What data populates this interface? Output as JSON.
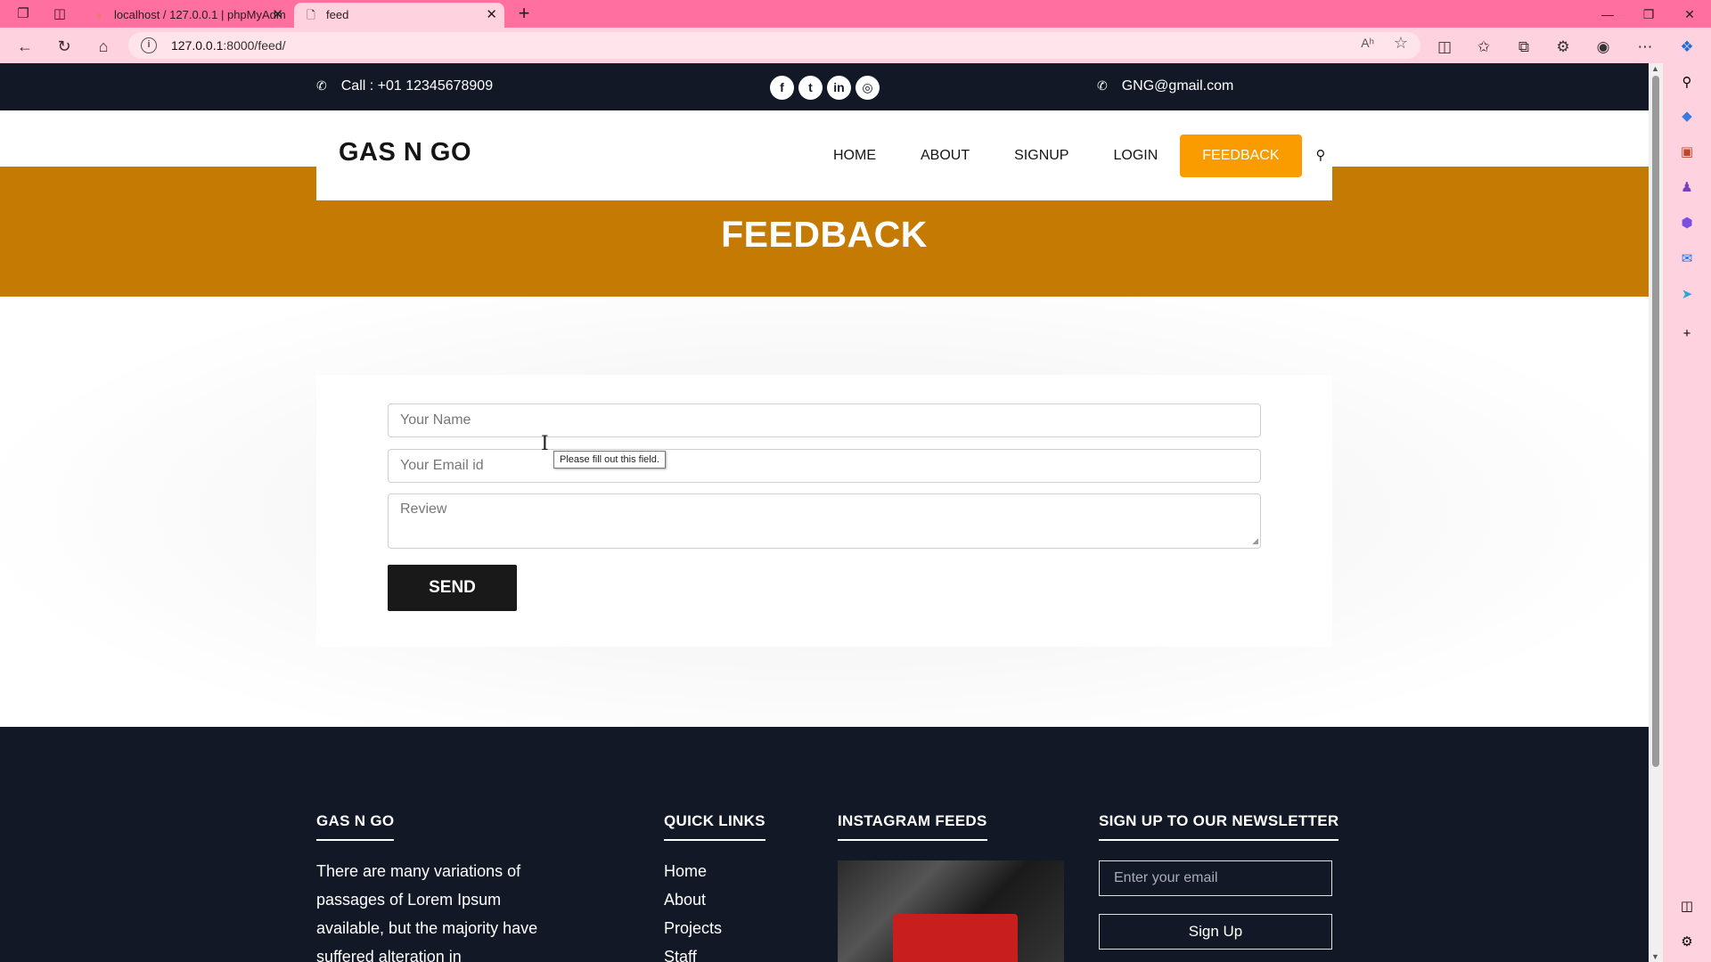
{
  "browser": {
    "tabs": [
      {
        "title": "localhost / 127.0.0.1 | phpMyAdm",
        "favicon": "phpmyadmin-icon"
      },
      {
        "title": "feed",
        "favicon": "page-icon",
        "active": true
      }
    ],
    "url_host": "127.0.0.1",
    "url_path": ":8000/feed/",
    "read_aloud": "Aʰ"
  },
  "topbar": {
    "phone": "Call : +01 12345678909",
    "email": "GNG@gmail.com",
    "social": [
      "f",
      "t",
      "in",
      "◎"
    ]
  },
  "nav": {
    "brand": "GAS N GO",
    "items": [
      "HOME",
      "ABOUT",
      "SIGNUP",
      "LOGIN",
      "FEEDBACK"
    ],
    "active": "FEEDBACK"
  },
  "banner": {
    "title": "FEEDBACK"
  },
  "form": {
    "name_placeholder": "Your Name",
    "email_placeholder": "Your Email id",
    "review_placeholder": "Review",
    "send_label": "SEND",
    "tooltip": "Please fill out this field."
  },
  "footer": {
    "about": {
      "heading": "GAS N GO",
      "text": "There are many variations of passages of Lorem Ipsum available, but the majority have suffered alteration in"
    },
    "quick_links": {
      "heading": "QUICK LINKS",
      "links": [
        "Home",
        "About",
        "Projects",
        "Staff"
      ]
    },
    "instagram": {
      "heading": "INSTAGRAM FEEDS"
    },
    "newsletter": {
      "heading": "SIGN UP TO OUR NEWSLETTER",
      "email_placeholder": "Enter your email",
      "button": "Sign Up"
    }
  },
  "colors": {
    "topbar_bg": "#121826",
    "banner_bg": "#c57a04",
    "accent": "#fa9b00",
    "browser_chrome": "#ff6fa0"
  }
}
